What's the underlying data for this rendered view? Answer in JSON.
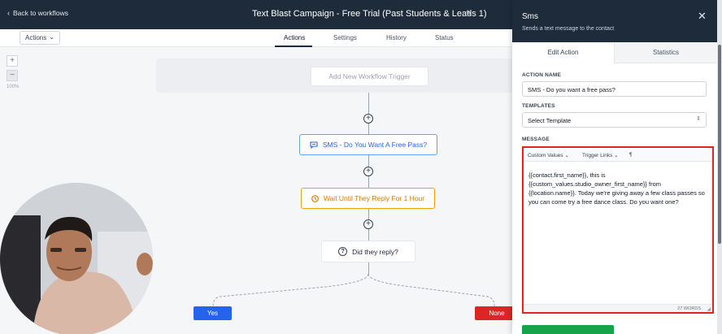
{
  "topbar": {
    "back_label": "Back to workflows",
    "title": "Text Blast Campaign - Free Trial (Past Students & Leads 1)"
  },
  "subbar": {
    "actions_dropdown": "Actions",
    "tabs": [
      {
        "label": "Actions",
        "active": true
      },
      {
        "label": "Settings",
        "active": false
      },
      {
        "label": "History",
        "active": false
      },
      {
        "label": "Status",
        "active": false
      }
    ]
  },
  "canvas": {
    "zoom_level": "100%",
    "trigger_label": "Add New Workflow Trigger",
    "nodes": {
      "sms": "SMS - Do You Want A Free Pass?",
      "wait": "Wait Until They Reply For 1 Hour",
      "condition": "Did they reply?"
    },
    "branches": {
      "yes": "Yes",
      "none": "None"
    }
  },
  "panel": {
    "title": "Sms",
    "subtitle": "Sends a text message to the contact",
    "tabs": [
      {
        "label": "Edit Action",
        "active": true
      },
      {
        "label": "Statistics",
        "active": false
      }
    ],
    "action_name_label": "ACTION NAME",
    "action_name_value": "SMS - Do you want a free pass?",
    "templates_label": "TEMPLATES",
    "templates_value": "Select Template",
    "message_label": "MESSAGE",
    "toolbar": {
      "custom_values": "Custom Values",
      "trigger_links": "Trigger Links",
      "paragraph": "¶"
    },
    "message_text": "{{contact.first_name}}, this is {{custom_values.studio_owner_first_name}} from {{location.name}}. Today we're giving away a few class passes so you can come try a free dance class. Do you want one?",
    "word_count": "27 WORDS"
  },
  "colors": {
    "header_bg": "#1e2b3a",
    "sms_accent": "#2563eb",
    "wait_accent": "#d97706",
    "yes_button": "#2563eb",
    "none_button": "#dc2626",
    "highlight_border": "#e02424"
  }
}
